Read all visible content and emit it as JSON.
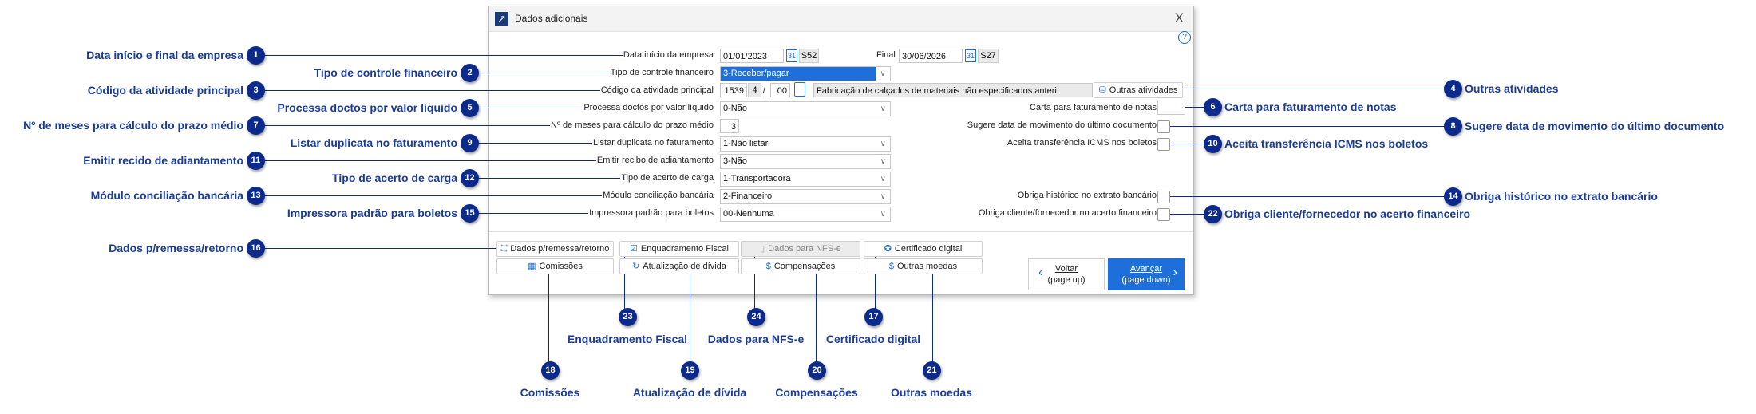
{
  "dialog": {
    "title": "Dados adicionais",
    "help": "?",
    "close": "X"
  },
  "fields": {
    "data_inicio": {
      "label": "Data início da empresa",
      "value": "01/01/2023",
      "week": "S52",
      "final_label": "Final",
      "final_value": "30/06/2026",
      "final_week": "S27",
      "cal": "31"
    },
    "tipo_controle": {
      "label": "Tipo de controle financeiro",
      "value": "3-Receber/pagar"
    },
    "codigo_atividade": {
      "label": "Código da atividade principal",
      "code": "1539",
      "digit": "4",
      "sep": "/",
      "sub": "00",
      "description": "Fabricação de calçados de materiais não especificados anteri",
      "button": "Outras atividades"
    },
    "processa": {
      "label": "Processa doctos por valor líquido",
      "value": "0-Não"
    },
    "meses": {
      "label": "Nº de meses para cálculo do prazo médio",
      "value": "3"
    },
    "listar": {
      "label": "Listar duplicata no faturamento",
      "value": "1-Não listar"
    },
    "emitir": {
      "label": "Emitir recibo de adiantamento",
      "value": "3-Não"
    },
    "acerto": {
      "label": "Tipo de acerto de carga",
      "value": "1-Transportadora"
    },
    "modulo": {
      "label": "Módulo conciliação bancária",
      "value": "2-Financeiro"
    },
    "impressora": {
      "label": "Impressora padrão para boletos",
      "value": "00-Nenhuma"
    },
    "carta": {
      "label": "Carta para faturamento de notas",
      "value": ""
    },
    "sugere": {
      "label": "Sugere data de movimento do último documento"
    },
    "aceita": {
      "label": "Aceita transferência ICMS nos boletos"
    },
    "obriga_hist": {
      "label": "Obriga histórico no extrato bancário"
    },
    "obriga_cli": {
      "label": "Obriga cliente/fornecedor no acerto financeiro"
    }
  },
  "buttons": {
    "remessa": "Dados p/remessa/retorno",
    "enquadramento": "Enquadramento Fiscal",
    "nfse": "Dados para NFS-e",
    "certificado": "Certificado digital",
    "comissoes": "Comissões",
    "atualizacao": "Atualização de dívida",
    "compensacoes": "Compensações",
    "moedas": "Outras moedas",
    "voltar": "Voltar",
    "voltar_sub": "(page up)",
    "avancar": "Avançar",
    "avancar_sub": "(page down)"
  },
  "annotations": [
    {
      "n": "1",
      "text": "Data início e final da empresa"
    },
    {
      "n": "2",
      "text": "Tipo de controle financeiro"
    },
    {
      "n": "3",
      "text": "Código da atividade principal"
    },
    {
      "n": "4",
      "text": "Outras atividades"
    },
    {
      "n": "5",
      "text": "Processa doctos por valor líquido"
    },
    {
      "n": "6",
      "text": "Carta para faturamento de notas"
    },
    {
      "n": "7",
      "text": "Nº de meses para cálculo do prazo médio"
    },
    {
      "n": "8",
      "text": "Sugere data de movimento do último documento"
    },
    {
      "n": "9",
      "text": "Listar duplicata no faturamento"
    },
    {
      "n": "10",
      "text": "Aceita transferência ICMS nos boletos"
    },
    {
      "n": "11",
      "text": "Emitir recido de adiantamento"
    },
    {
      "n": "12",
      "text": "Tipo de acerto de carga"
    },
    {
      "n": "13",
      "text": "Módulo conciliação bancária"
    },
    {
      "n": "14",
      "text": "Obriga histórico no extrato bancário"
    },
    {
      "n": "15",
      "text": "Impressora padrão para boletos"
    },
    {
      "n": "16",
      "text": "Dados p/remessa/retorno"
    },
    {
      "n": "17",
      "text": "Certificado digital"
    },
    {
      "n": "18",
      "text": "Comissões"
    },
    {
      "n": "19",
      "text": "Atualização de dívida"
    },
    {
      "n": "20",
      "text": "Compensações"
    },
    {
      "n": "21",
      "text": "Outras moedas"
    },
    {
      "n": "22",
      "text": "Obriga cliente/fornecedor no acerto financeiro"
    },
    {
      "n": "23",
      "text": "Enquadramento Fiscal"
    },
    {
      "n": "24",
      "text": "Dados para NFS-e"
    }
  ],
  "colors": {
    "badge": "#0b2a8c",
    "annotation_text": "#1a3c96",
    "accent": "#1e6fd9"
  }
}
